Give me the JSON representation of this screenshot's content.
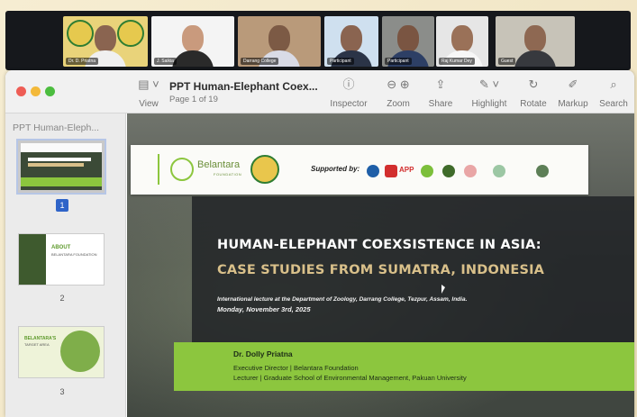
{
  "video_call": {
    "participants": [
      {
        "name": "Dr. D. Priatna"
      },
      {
        "name": "J. Saikia"
      },
      {
        "name": "Darrang College"
      },
      {
        "name": "Participant"
      },
      {
        "name": "Participant"
      },
      {
        "name": "Raj Kumar Dey"
      },
      {
        "name": "Guest"
      }
    ]
  },
  "toolbar": {
    "view": "View",
    "inspector": "Inspector",
    "zoom": "Zoom",
    "share": "Share",
    "highlight": "Highlight",
    "rotate": "Rotate",
    "markup": "Markup",
    "search": "Search"
  },
  "document": {
    "title": "PPT Human-Elephant Coex...",
    "page_info": "Page 1 of 19"
  },
  "sidebar": {
    "title": "PPT Human-Eleph...",
    "pages": [
      "1",
      "2",
      "3"
    ],
    "thumb2_heading": "ABOUT",
    "thumb2_sub": "BELANTARA FOUNDATION",
    "thumb3_heading": "BELANTARA'S",
    "thumb3_sub": "TARGET AREA"
  },
  "slide": {
    "org_name": "Belantara",
    "org_tag": "FOUNDATION",
    "supported_by": "Supported by:",
    "sponsor_app": "APP",
    "title_line1": "HUMAN-ELEPHANT COEXSISTENCE IN ASIA:",
    "title_line2": "CASE STUDIES FROM SUMATRA, INDONESIA",
    "subtitle": "International lecture at the Department of Zoology, Darrang College, Tezpur, Assam, India.",
    "date": "Monday, November 3rd, 2025",
    "speaker_name": "Dr. Dolly Priatna",
    "speaker_role1": "Executive Director  |  Belantara Foundation",
    "speaker_role2": "Lecturer  |  Graduate School of Environmental Management, Pakuan University"
  },
  "colors": {
    "accent_green": "#8cc63e",
    "title_white": "#ffffff",
    "title_gold": "#d9c08a",
    "selection_blue": "#2f64c8"
  }
}
